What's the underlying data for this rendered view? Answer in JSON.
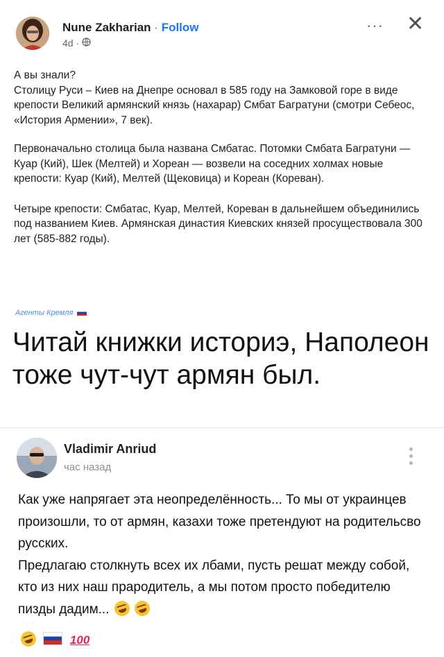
{
  "fb_post": {
    "author": "Nune Zakharian",
    "separator": "·",
    "follow_label": "Follow",
    "time": "4d ·",
    "icon_globe": "globe-icon",
    "more_label": "···",
    "close_label": "✕",
    "paragraphs": [
      "А вы знали?\nСтолицу Руси – Киев на Днепре основал в 585 году на Замковой горе в виде крепости Великий армянский князь (нахарар) Смбат Багратуни (смотри Себеос, «История Армении», 7 век).",
      "Первоначально столица была названа Смбатас. Потомки Смбата Багратуни — Куар (Кий), Шек (Мелтей) и Хореан — возвели на соседних холмах новые крепости: Куар (Кий), Мелтей (Щековица) и Кореан (Кореван).",
      "Четыре крепости: Смбатас, Куар, Мелтей, Кореван в дальнейшем объединились под названием Киев. Армянская династия Киевских князей просуществовала 300 лет (585-882 годы)."
    ]
  },
  "watermark_tag": "Агенты Кремля",
  "big_caption": "Читай книжки историэ, Наполеон тоже чут-чут армян был.",
  "vk_comment": {
    "author": "Vladimir Anriud",
    "time": "час назад",
    "text_main": "Как уже напрягает эта неопределённость... То мы от украинцев произошли, то от армян, казахи тоже претендуют на родительсво русских.\nПредлагаю столкнуть всех их лбами, пусть решат между собой, кто из них наш прародитель, а мы потом просто победителю пизды дадим...",
    "emoji_hundred": "100"
  }
}
